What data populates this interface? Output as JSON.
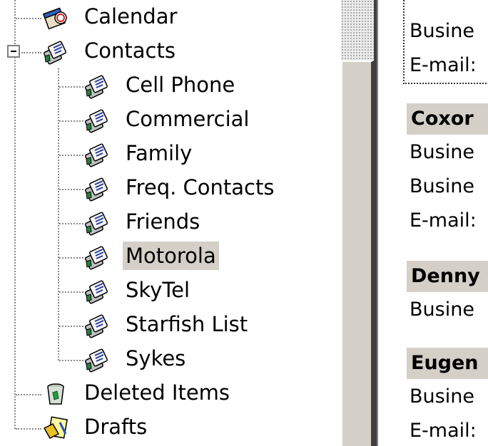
{
  "folder_tree": {
    "items": [
      {
        "label": "Calendar",
        "icon": "calendar-icon"
      },
      {
        "label": "Contacts",
        "icon": "contacts-icon",
        "expanded": true
      },
      {
        "label": "Cell Phone",
        "icon": "contacts-icon"
      },
      {
        "label": "Commercial",
        "icon": "contacts-icon"
      },
      {
        "label": "Family",
        "icon": "contacts-icon"
      },
      {
        "label": "Freq. Contacts",
        "icon": "contacts-icon"
      },
      {
        "label": "Friends",
        "icon": "contacts-icon"
      },
      {
        "label": "Motorola",
        "icon": "contacts-icon",
        "selected": true
      },
      {
        "label": "SkyTel",
        "icon": "contacts-icon"
      },
      {
        "label": "Starfish List",
        "icon": "contacts-icon"
      },
      {
        "label": "Sykes",
        "icon": "contacts-icon"
      },
      {
        "label": "Deleted Items",
        "icon": "deleted-items-icon"
      },
      {
        "label": "Drafts",
        "icon": "drafts-icon"
      }
    ]
  },
  "contact_list": {
    "first_card": {
      "line1": "Busine",
      "line2": "E-mail:"
    },
    "cards": [
      {
        "name": "Coxor",
        "lines": [
          "Busine",
          "Busine",
          "E-mail:"
        ]
      },
      {
        "name": "Denny",
        "lines": [
          "Busine"
        ]
      },
      {
        "name": "Eugen",
        "lines": [
          "Busine",
          "E-mail:"
        ]
      }
    ]
  },
  "colors": {
    "selection": "#d4d0c8",
    "tree_lines": "#8a8a8a",
    "header_bg": "#d4d0c8"
  }
}
